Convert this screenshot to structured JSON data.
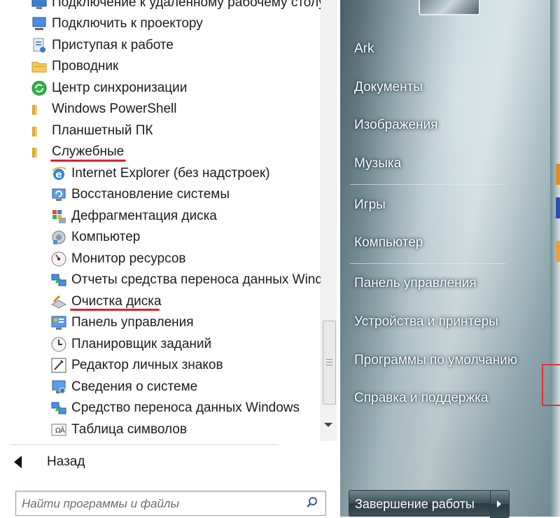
{
  "left_menu": {
    "items": [
      {
        "label": "Подключение к удаленному рабочему столу",
        "icon": "remote-desktop-icon",
        "indent": false
      },
      {
        "label": "Подключить к проектору",
        "icon": "projector-icon",
        "indent": false
      },
      {
        "label": "Приступая к работе",
        "icon": "getting-started-icon",
        "indent": false
      },
      {
        "label": "Проводник",
        "icon": "explorer-folder-icon",
        "indent": false
      },
      {
        "label": "Центр синхронизации",
        "icon": "sync-center-icon",
        "indent": false
      },
      {
        "label": "Windows PowerShell",
        "icon": "folder-icon",
        "indent": false
      },
      {
        "label": "Планшетный ПК",
        "icon": "folder-icon",
        "indent": false
      },
      {
        "label": "Служебные",
        "icon": "folder-open-icon",
        "indent": false
      },
      {
        "label": "Internet Explorer (без надстроек)",
        "icon": "internet-explorer-icon",
        "indent": true
      },
      {
        "label": "Восстановление системы",
        "icon": "system-restore-icon",
        "indent": true
      },
      {
        "label": "Дефрагментация диска",
        "icon": "disk-defragmenter-icon",
        "indent": true
      },
      {
        "label": "Компьютер",
        "icon": "computer-icon",
        "indent": true
      },
      {
        "label": "Монитор ресурсов",
        "icon": "resource-monitor-icon",
        "indent": true
      },
      {
        "label": "Отчеты средства переноса данных Windows",
        "icon": "transfer-reports-icon",
        "indent": true
      },
      {
        "label": "Очистка диска",
        "icon": "disk-cleanup-icon",
        "indent": true
      },
      {
        "label": "Панель управления",
        "icon": "control-panel-icon",
        "indent": true
      },
      {
        "label": "Планировщик заданий",
        "icon": "task-scheduler-icon",
        "indent": true
      },
      {
        "label": "Редактор личных знаков",
        "icon": "character-editor-icon",
        "indent": true
      },
      {
        "label": "Сведения о системе",
        "icon": "system-info-icon",
        "indent": true
      },
      {
        "label": "Средство переноса данных Windows",
        "icon": "easy-transfer-icon",
        "indent": true
      },
      {
        "label": "Таблица символов",
        "icon": "character-map-icon",
        "indent": true
      }
    ],
    "back_label": "Назад"
  },
  "search": {
    "placeholder": "Найти программы и файлы"
  },
  "right_menu": {
    "items": [
      "Ark",
      "Документы",
      "Изображения",
      "Музыка",
      "Игры",
      "Компьютер",
      "Панель управления",
      "Устройства и принтеры",
      "Программы по умолчанию",
      "Справка и поддержка"
    ],
    "shutdown_label": "Завершение работы"
  },
  "colors": {
    "highlight_underline": "#d9232e",
    "right_pane_text": "#ffffff"
  }
}
